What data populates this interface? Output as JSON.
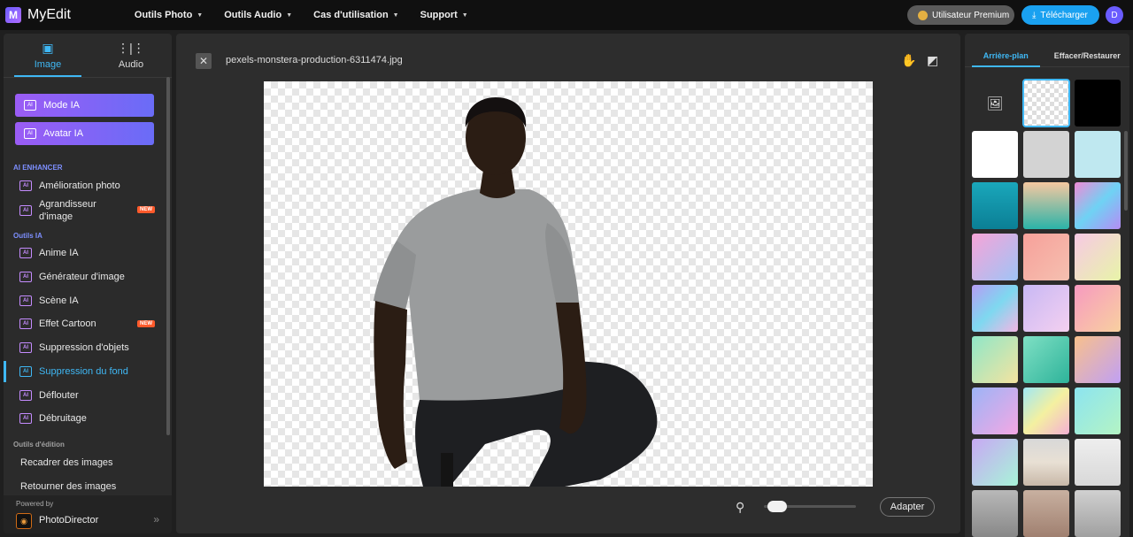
{
  "app": {
    "logo_letter": "M",
    "name": "MyEdit"
  },
  "nav": [
    {
      "label": "Outils Photo"
    },
    {
      "label": "Outils Audio"
    },
    {
      "label": "Cas d'utilisation"
    },
    {
      "label": "Support"
    }
  ],
  "header": {
    "premium_label": "Utilisateur Premium",
    "download_label": "Télécharger",
    "avatar_letter": "D"
  },
  "left": {
    "tabs": [
      {
        "label": "Image"
      },
      {
        "label": "Audio"
      }
    ],
    "ai_buttons": [
      {
        "label": "Mode IA"
      },
      {
        "label": "Avatar IA"
      }
    ],
    "sections": [
      {
        "label": "AI ENHANCER"
      },
      {
        "label": "Outils IA"
      },
      {
        "label": "Outils d'édition"
      }
    ],
    "enhancer_items": [
      {
        "label": "Amélioration photo"
      },
      {
        "label": "Agrandisseur d'image",
        "badge": "NEW"
      }
    ],
    "ai_items": [
      {
        "label": "Anime IA"
      },
      {
        "label": "Générateur d'image"
      },
      {
        "label": "Scène IA"
      },
      {
        "label": "Effet Cartoon",
        "badge": "NEW"
      },
      {
        "label": "Suppression d'objets"
      },
      {
        "label": "Suppression du fond"
      },
      {
        "label": "Déflouter"
      },
      {
        "label": "Débruitage"
      }
    ],
    "edit_items": [
      {
        "label": "Recadrer des images"
      },
      {
        "label": "Retourner des images"
      }
    ],
    "powered_by": "Powered by",
    "product": "PhotoDirector",
    "ai_icon_text": "AI"
  },
  "editor": {
    "filename": "pexels-monstera-production-6311474.jpg",
    "fit_label": "Adapter",
    "zoom_level": 0.05
  },
  "right": {
    "tabs": [
      {
        "label": "Arrière-plan"
      },
      {
        "label": "Effacer/Restaurer"
      }
    ],
    "selected_swatch": "transparent",
    "accent": "#3fb8f5"
  }
}
